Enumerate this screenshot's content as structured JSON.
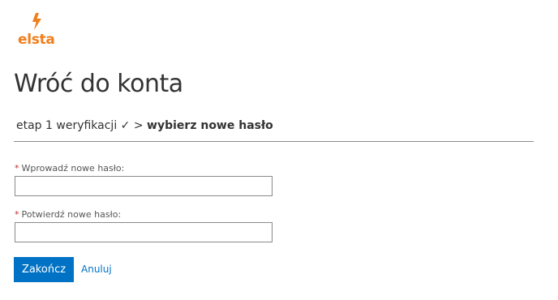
{
  "brand": {
    "name": "elsta",
    "color": "#f07f1e",
    "icon": "lightning-bolt-icon"
  },
  "page": {
    "title": "Wróć do konta"
  },
  "steps": {
    "step1_label": "etap 1 weryfikacji",
    "step1_check": "✓",
    "separator": ">",
    "current": "wybierz nowe hasło"
  },
  "form": {
    "required_marker": "*",
    "new_password_label": "Wprowadź nowe hasło:",
    "new_password_value": "",
    "confirm_password_label": "Potwierdź nowe hasło:",
    "confirm_password_value": ""
  },
  "actions": {
    "submit_label": "Zakończ",
    "cancel_label": "Anuluj",
    "accent_color": "#0072c6"
  }
}
